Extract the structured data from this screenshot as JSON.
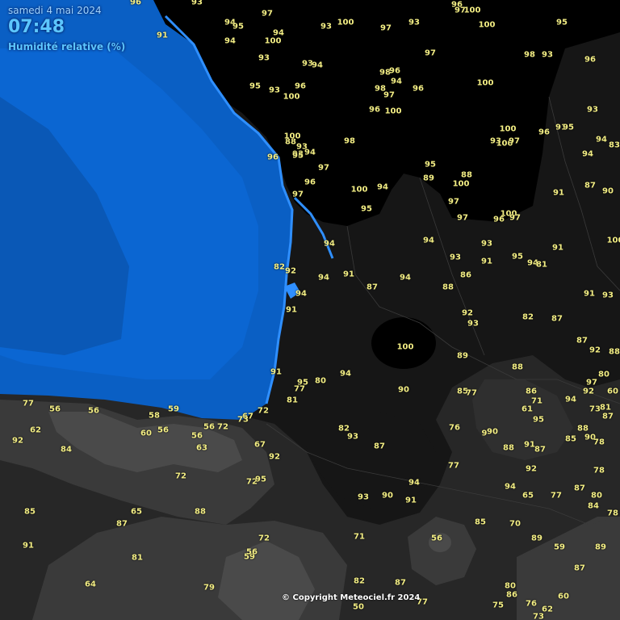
{
  "header": {
    "date": "samedi 4 mai 2024",
    "time": "07:48",
    "variable": "Humidité relative (%)"
  },
  "copyright": "© Copyright Meteociel.fr 2024",
  "colors": {
    "sea": "#0a5fc4",
    "sea_open": "#0b67d4",
    "coast_highlight": "#2f8fff",
    "level_95_100": "#000000",
    "level_85_95": "#161616",
    "level_75_85": "#272727",
    "level_65_75": "#3a3a3a",
    "level_55_65": "#4d4d4d",
    "level_45_55": "#616161",
    "value_text": "#f3ee84",
    "header_text": "#5cc6ff"
  },
  "observations": [
    {
      "v": "96"
    },
    {
      "v": "93"
    },
    {
      "v": "96"
    },
    {
      "v": "97"
    },
    {
      "v": "100"
    },
    {
      "v": "97"
    },
    {
      "v": "94"
    },
    {
      "v": "95"
    },
    {
      "v": "100"
    },
    {
      "v": "93"
    },
    {
      "v": "97"
    },
    {
      "v": "93"
    },
    {
      "v": "100"
    },
    {
      "v": "95"
    },
    {
      "v": "91"
    },
    {
      "v": "94"
    },
    {
      "v": "94"
    },
    {
      "v": "100"
    },
    {
      "v": "93"
    },
    {
      "v": "93"
    },
    {
      "v": "94"
    },
    {
      "v": "97"
    },
    {
      "v": "98"
    },
    {
      "v": "93"
    },
    {
      "v": "96"
    },
    {
      "v": "98"
    },
    {
      "v": "96"
    },
    {
      "v": "94"
    },
    {
      "v": "100"
    },
    {
      "v": "95"
    },
    {
      "v": "93"
    },
    {
      "v": "96"
    },
    {
      "v": "100"
    },
    {
      "v": "98"
    },
    {
      "v": "97"
    },
    {
      "v": "96"
    },
    {
      "v": "96"
    },
    {
      "v": "100"
    },
    {
      "v": "93"
    },
    {
      "v": "100"
    },
    {
      "v": "91"
    },
    {
      "v": "95"
    },
    {
      "v": "96"
    },
    {
      "v": "93"
    },
    {
      "v": "100"
    },
    {
      "v": "88"
    },
    {
      "v": "93"
    },
    {
      "v": "98"
    },
    {
      "v": "93"
    },
    {
      "v": "100"
    },
    {
      "v": "97"
    },
    {
      "v": "94"
    },
    {
      "v": "83"
    },
    {
      "v": "95"
    },
    {
      "v": "96"
    },
    {
      "v": "94"
    },
    {
      "v": "94"
    },
    {
      "v": "97"
    },
    {
      "v": "95"
    },
    {
      "v": "89"
    },
    {
      "v": "88"
    },
    {
      "v": "100"
    },
    {
      "v": "87"
    },
    {
      "v": "90"
    },
    {
      "v": "96"
    },
    {
      "v": "97"
    },
    {
      "v": "100"
    },
    {
      "v": "94"
    },
    {
      "v": "91"
    },
    {
      "v": "97"
    },
    {
      "v": "100"
    },
    {
      "v": "95"
    },
    {
      "v": "97"
    },
    {
      "v": "97"
    },
    {
      "v": "96"
    },
    {
      "v": "100"
    },
    {
      "v": "94"
    },
    {
      "v": "94"
    },
    {
      "v": "93"
    },
    {
      "v": "91"
    },
    {
      "v": "93"
    },
    {
      "v": "95"
    },
    {
      "v": "94"
    },
    {
      "v": "81"
    },
    {
      "v": "82"
    },
    {
      "v": "92"
    },
    {
      "v": "94"
    },
    {
      "v": "91"
    },
    {
      "v": "87"
    },
    {
      "v": "94"
    },
    {
      "v": "88"
    },
    {
      "v": "86"
    },
    {
      "v": "91"
    },
    {
      "v": "93"
    },
    {
      "v": "94"
    },
    {
      "v": "91"
    },
    {
      "v": "92"
    },
    {
      "v": "93"
    },
    {
      "v": "82"
    },
    {
      "v": "87"
    },
    {
      "v": "80"
    },
    {
      "v": "87"
    },
    {
      "v": "100"
    },
    {
      "v": "92"
    },
    {
      "v": "89"
    },
    {
      "v": "88"
    },
    {
      "v": "91"
    },
    {
      "v": "91"
    },
    {
      "v": "95"
    },
    {
      "v": "80"
    },
    {
      "v": "94"
    },
    {
      "v": "90"
    },
    {
      "v": "85"
    },
    {
      "v": "77"
    },
    {
      "v": "86"
    },
    {
      "v": "97"
    },
    {
      "v": "88"
    },
    {
      "v": "77"
    },
    {
      "v": "81"
    },
    {
      "v": "71"
    },
    {
      "v": "94"
    },
    {
      "v": "92"
    },
    {
      "v": "60"
    },
    {
      "v": "56"
    },
    {
      "v": "56"
    },
    {
      "v": "59"
    },
    {
      "v": "58"
    },
    {
      "v": "72"
    },
    {
      "v": "77"
    },
    {
      "v": "56"
    },
    {
      "v": "61"
    },
    {
      "v": "95"
    },
    {
      "v": "73"
    },
    {
      "v": "81"
    },
    {
      "v": "87"
    },
    {
      "v": "62"
    },
    {
      "v": "60"
    },
    {
      "v": "56"
    },
    {
      "v": "67"
    },
    {
      "v": "82"
    },
    {
      "v": "93"
    },
    {
      "v": "76"
    },
    {
      "v": "9"
    },
    {
      "v": "90"
    },
    {
      "v": "88"
    },
    {
      "v": "85"
    },
    {
      "v": "90"
    },
    {
      "v": "92"
    },
    {
      "v": "56"
    },
    {
      "v": "72"
    },
    {
      "v": "73"
    },
    {
      "v": "78"
    },
    {
      "v": "84"
    },
    {
      "v": "88"
    },
    {
      "v": "63"
    },
    {
      "v": "67"
    },
    {
      "v": "87"
    },
    {
      "v": "91"
    },
    {
      "v": "87"
    },
    {
      "v": "92"
    },
    {
      "v": "77"
    },
    {
      "v": "78"
    },
    {
      "v": "72"
    },
    {
      "v": "72"
    },
    {
      "v": "95"
    },
    {
      "v": "92"
    },
    {
      "v": "94"
    },
    {
      "v": "93"
    },
    {
      "v": "90"
    },
    {
      "v": "91"
    },
    {
      "v": "94"
    },
    {
      "v": "65"
    },
    {
      "v": "77"
    },
    {
      "v": "87"
    },
    {
      "v": "80"
    },
    {
      "v": "84"
    },
    {
      "v": "78"
    },
    {
      "v": "85"
    },
    {
      "v": "65"
    },
    {
      "v": "87"
    },
    {
      "v": "88"
    },
    {
      "v": "85"
    },
    {
      "v": "70"
    },
    {
      "v": "71"
    },
    {
      "v": "56"
    },
    {
      "v": "89"
    },
    {
      "v": "72"
    },
    {
      "v": "59"
    },
    {
      "v": "89"
    },
    {
      "v": "91"
    },
    {
      "v": "56"
    },
    {
      "v": "59"
    },
    {
      "v": "81"
    },
    {
      "v": "87"
    },
    {
      "v": "64"
    },
    {
      "v": "79"
    },
    {
      "v": "82"
    },
    {
      "v": "87"
    },
    {
      "v": "80"
    },
    {
      "v": "60"
    },
    {
      "v": "86"
    },
    {
      "v": "50"
    },
    {
      "v": "77"
    },
    {
      "v": "75"
    },
    {
      "v": "76"
    },
    {
      "v": "62"
    },
    {
      "v": "73"
    }
  ]
}
